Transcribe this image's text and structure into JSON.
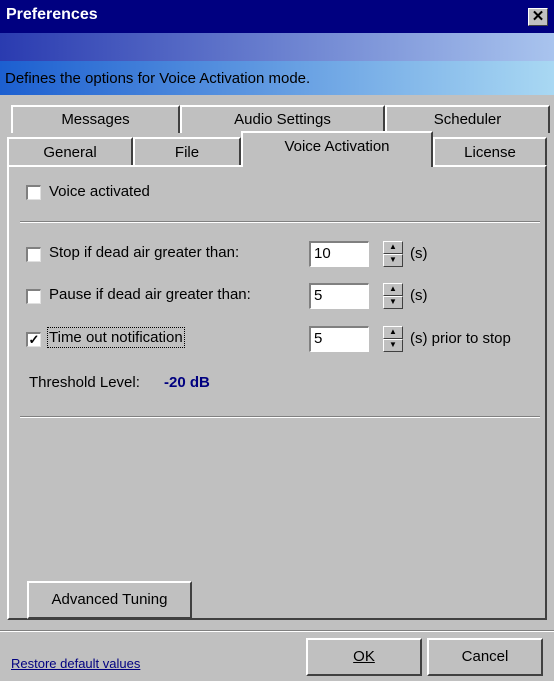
{
  "window": {
    "title": "Preferences",
    "close_glyph": "✕"
  },
  "banner": {
    "description": "Defines the options for Voice Activation mode."
  },
  "tabs": {
    "back_row": [
      "Messages",
      "Audio Settings",
      "Scheduler"
    ],
    "front_row": [
      "General",
      "File",
      "Voice Activation",
      "License"
    ],
    "selected": "Voice Activation"
  },
  "voice": {
    "voice_activated": {
      "label": "Voice activated",
      "checked": false
    },
    "stop_dead_air": {
      "label": "Stop if dead air greater than:",
      "checked": false,
      "value": "10",
      "unit": "(s)"
    },
    "pause_dead_air": {
      "label": "Pause if dead air greater than:",
      "checked": false,
      "value": "5",
      "unit": "(s)"
    },
    "timeout_notification": {
      "label": "Time out notification",
      "checked": true,
      "value": "5",
      "unit": "(s) prior to stop"
    },
    "threshold": {
      "label": "Threshold Level:",
      "value": "-20 dB",
      "color": "#000080"
    },
    "advanced_tuning_label": "Advanced Tuning"
  },
  "footer": {
    "restore_label": "Restore default values",
    "ok_label": "OK",
    "cancel_label": "Cancel"
  },
  "icons": {
    "spinner": "up-down-arrows",
    "check": "checkmark"
  }
}
